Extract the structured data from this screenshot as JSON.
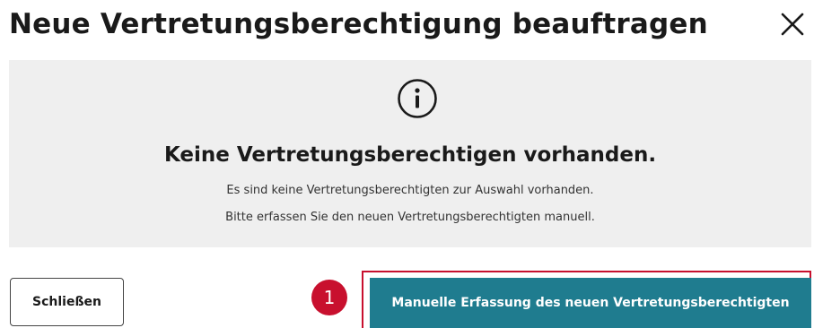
{
  "dialog": {
    "title": "Neue Vertretungsberechtigung beauftragen",
    "close_icon": "close-icon"
  },
  "info": {
    "icon": "info-icon",
    "heading": "Keine Vertretungsberechtigen vorhanden.",
    "line1": "Es sind keine Vertretungsberechtigten zur Auswahl vorhanden.",
    "line2": "Bitte erfassen Sie den neuen Vertretungsberechtigten manuell."
  },
  "footer": {
    "close_label": "Schließen",
    "step_badge": "1",
    "primary_label": "Manuelle Erfassung des neuen Vertretungsberechtigten"
  },
  "colors": {
    "primary": "#1f7c8f",
    "badge": "#c8102e",
    "panel": "#efefef"
  }
}
